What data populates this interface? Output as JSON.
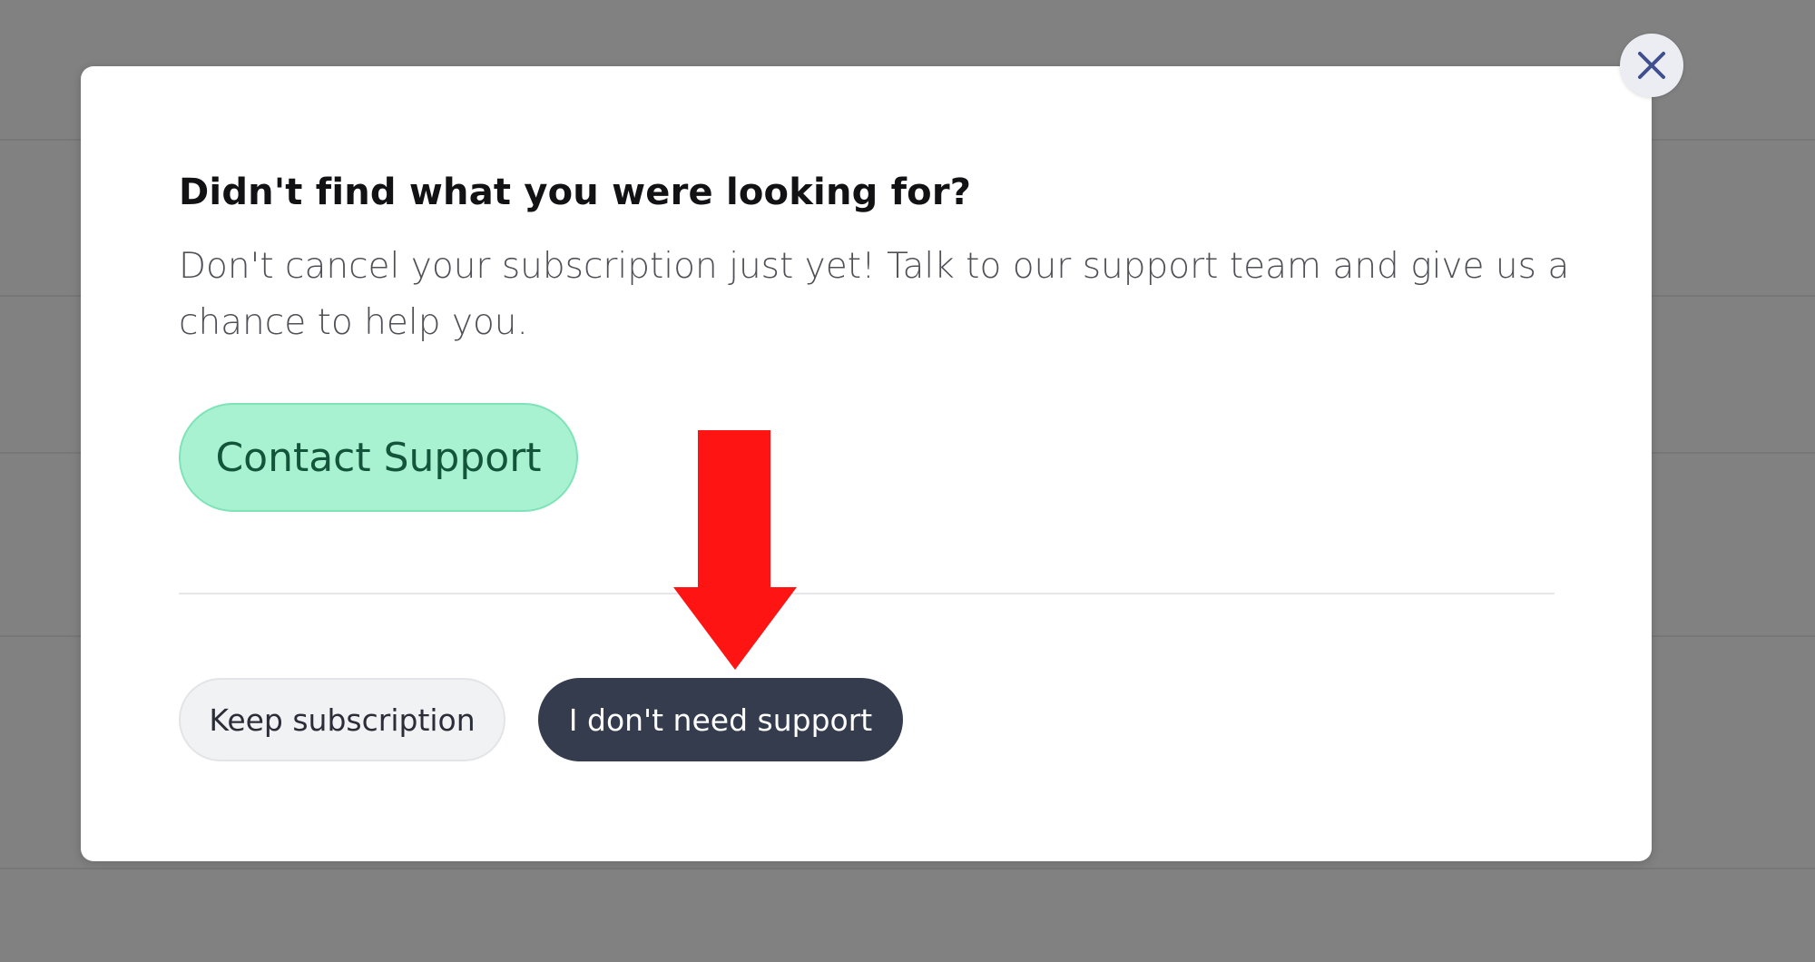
{
  "modal": {
    "title": "Didn't find what you were looking for?",
    "description": "Don't cancel your subscription just yet! Talk to our support team and give us a chance to help you.",
    "contact_button": "Contact Support",
    "keep_button": "Keep subscription",
    "no_support_button": "I don't need support",
    "close_icon": "close-icon"
  },
  "annotation": {
    "icon": "red-down-arrow",
    "color": "#ff1414"
  },
  "colors": {
    "overlay": "#808180",
    "contact_bg": "#a8f2d1",
    "contact_text": "#13553b",
    "primary_dark": "#353c4e",
    "close_icon": "#3f4f8f"
  }
}
